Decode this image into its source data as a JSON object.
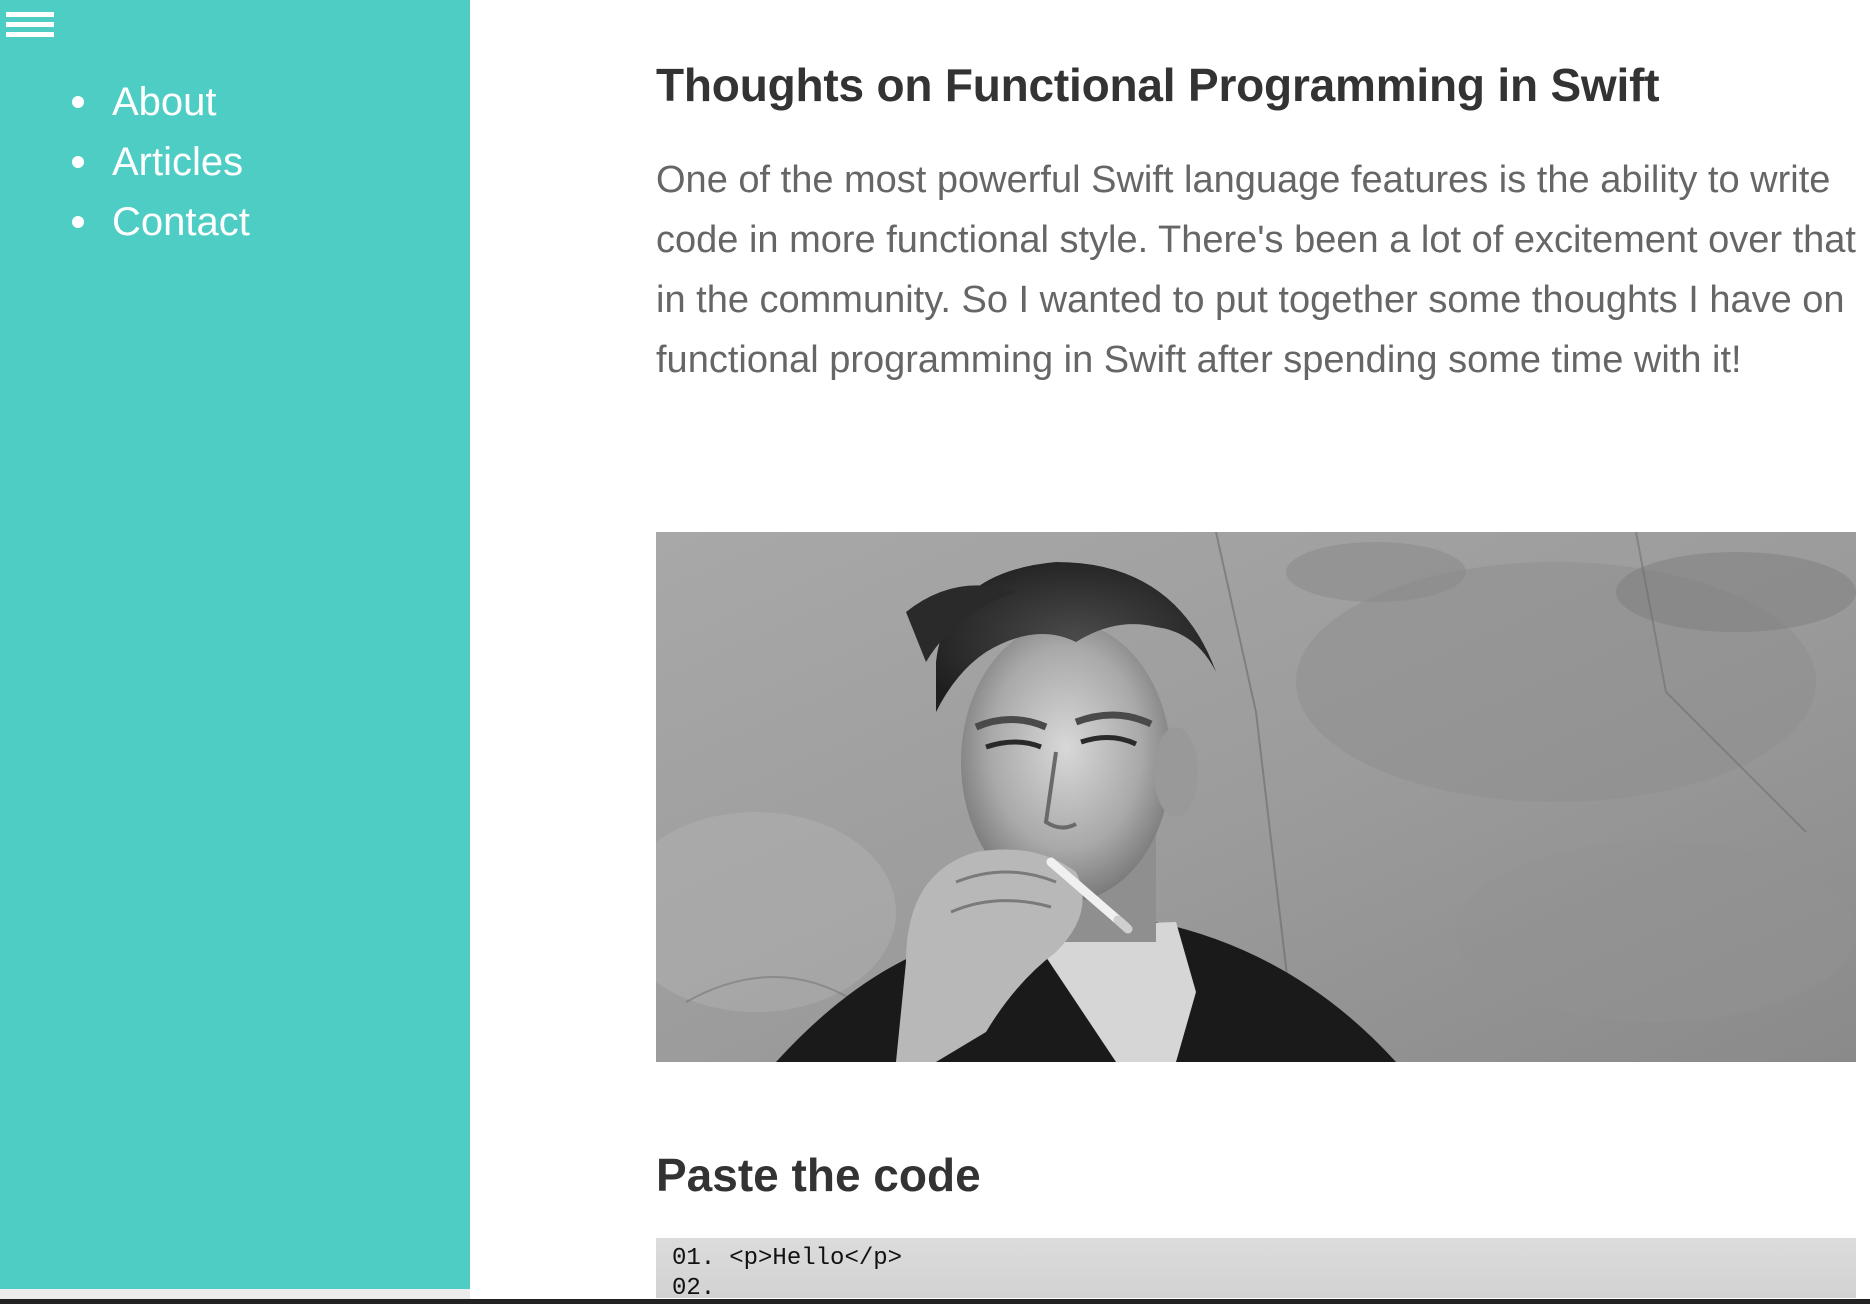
{
  "sidebar": {
    "menu_icon": "hamburger-menu-icon",
    "background_color": "#4ecdc4",
    "items": [
      {
        "label": "About"
      },
      {
        "label": "Articles"
      },
      {
        "label": "Contact"
      }
    ]
  },
  "article": {
    "title": "Thoughts on Functional Programming in Swift",
    "intro": "One of the most powerful Swift language features is the ability to write code in more functional style. There's been a lot of excitement over that in the community. So I wanted to put together some thoughts I have on functional programming in Swift after spending some time with it!",
    "image": {
      "description_icon": "black-and-white-portrait-photo",
      "style": "grayscale"
    },
    "section_heading": "Paste the code",
    "code_lines": [
      {
        "number": "01.",
        "text": "<p>Hello</p>"
      },
      {
        "number": "02.",
        "text": ""
      }
    ]
  }
}
